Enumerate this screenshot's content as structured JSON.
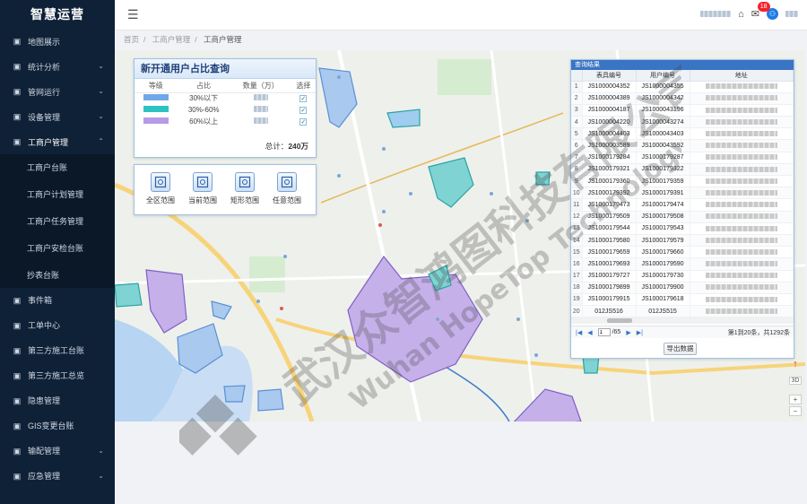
{
  "app": {
    "title": "智慧运营"
  },
  "sidebar": {
    "items": [
      {
        "label": "地图展示",
        "icon": "image-icon",
        "chevron": false
      },
      {
        "label": "统计分析",
        "icon": "bar-chart-icon",
        "chevron": true
      },
      {
        "label": "管网运行",
        "icon": "gauge-icon",
        "chevron": true
      },
      {
        "label": "设备管理",
        "icon": "device-icon",
        "chevron": true
      },
      {
        "label": "工商户管理",
        "icon": "gear-icon",
        "chevron": true,
        "expanded": true
      }
    ],
    "sub_items": [
      {
        "label": "工商户台账"
      },
      {
        "label": "工商户计划管理"
      },
      {
        "label": "工商户任务管理"
      },
      {
        "label": "工商户安检台账"
      },
      {
        "label": "抄表台账"
      }
    ],
    "items_after": [
      {
        "label": "事件箱",
        "icon": "inbox-icon"
      },
      {
        "label": "工单中心",
        "icon": "document-icon"
      },
      {
        "label": "第三方施工台账",
        "icon": "list-icon"
      },
      {
        "label": "第三方施工总览",
        "icon": "list-icon"
      },
      {
        "label": "隐患管理",
        "icon": "warning-icon"
      },
      {
        "label": "GIS变更台账",
        "icon": "map-icon"
      },
      {
        "label": "输配管理",
        "icon": "pipe-icon",
        "chevron": true
      },
      {
        "label": "应急管理",
        "icon": "emergency-icon",
        "chevron": true
      }
    ]
  },
  "topbar": {
    "notification_count": "18"
  },
  "breadcrumb": [
    "首页",
    "工商户管理",
    "工商户管理"
  ],
  "stat_panel": {
    "title": "新开通用户占比查询",
    "headers": [
      "等级",
      "占比",
      "数量（万）",
      "选择"
    ],
    "rows": [
      {
        "ratio": "30%以下",
        "color": "#6fa8e8",
        "checked": "✓"
      },
      {
        "ratio": "30%-60%",
        "color": "#2fc2c2",
        "checked": "✓"
      },
      {
        "ratio": "60%以上",
        "color": "#b79be6",
        "checked": "✓"
      }
    ],
    "total_label": "总计：",
    "total_value": "240万"
  },
  "tools": [
    {
      "label": "全区范围",
      "icon": "full-extent-icon"
    },
    {
      "label": "当前范围",
      "icon": "current-extent-icon"
    },
    {
      "label": "矩形范围",
      "icon": "rectangle-select-icon"
    },
    {
      "label": "任意范围",
      "icon": "polygon-select-icon"
    }
  ],
  "results": {
    "title": "查询结果",
    "headers": [
      "",
      "表具编号",
      "用户编号",
      "地址"
    ],
    "rows": [
      [
        "1",
        "JS1000004352",
        "JS1000004355"
      ],
      [
        "2",
        "JS1000004389",
        "JS1000004342"
      ],
      [
        "3",
        "JS1000004187",
        "JS1000043196"
      ],
      [
        "4",
        "JS1000004220",
        "JS1000043274"
      ],
      [
        "5",
        "JS1000004403",
        "JS1000043403"
      ],
      [
        "6",
        "JS1000003589",
        "JS1000043592"
      ],
      [
        "7",
        "JS1000179284",
        "JS1000179287"
      ],
      [
        "8",
        "JS1000179321",
        "JS1000179322"
      ],
      [
        "9",
        "JS1000179360",
        "JS1000179359"
      ],
      [
        "10",
        "JS1000179392",
        "JS1000179391"
      ],
      [
        "11",
        "JS1000179473",
        "JS1000179474"
      ],
      [
        "12",
        "JS1000179509",
        "JS1000179508"
      ],
      [
        "13",
        "JS1000179544",
        "JS1000179543"
      ],
      [
        "14",
        "JS1000179580",
        "JS1000179579"
      ],
      [
        "15",
        "JS1000179659",
        "JS1000179660"
      ],
      [
        "16",
        "JS1000179693",
        "JS1000179590"
      ],
      [
        "17",
        "JS1000179727",
        "JS1000179730"
      ],
      [
        "18",
        "JS1000179899",
        "JS1000179900"
      ],
      [
        "19",
        "JS1000179915",
        "JS1000179618"
      ],
      [
        "20",
        "012JS516",
        "012JS515"
      ]
    ],
    "page_current": "1",
    "page_total": "/65",
    "summary": "第1到20条，共1292条",
    "export_label": "导出数据"
  },
  "map_controls": {
    "compass": "↑",
    "mode": "3D",
    "zoom_in": "+",
    "zoom_out": "−"
  }
}
